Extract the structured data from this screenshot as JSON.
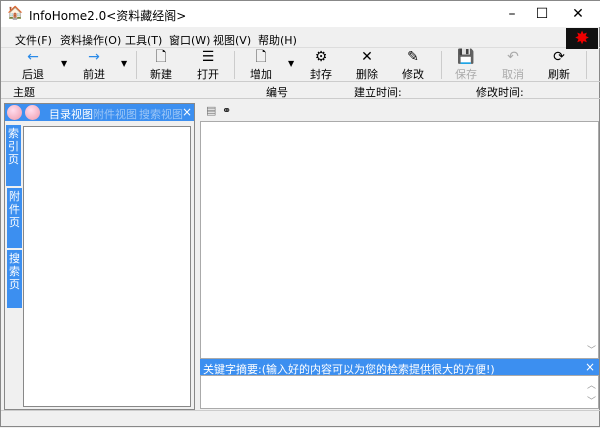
{
  "window": {
    "title": "InfoHome2.0<资料藏经阁>",
    "minimize": "–",
    "maximize": "☐",
    "close": "✕"
  },
  "menu": [
    "文件(F)",
    "资料操作(O)",
    "工具(T)",
    "窗口(W)",
    "视图(V)",
    "帮助(H)"
  ],
  "toolbar": [
    {
      "label": "后退",
      "icon": "←"
    },
    {
      "label": "前进",
      "icon": "→"
    },
    {
      "label": "新建",
      "icon": "🗋"
    },
    {
      "label": "打开",
      "icon": "☰"
    },
    {
      "label": "增加",
      "icon": "🗋"
    },
    {
      "label": "封存",
      "icon": "⚙"
    },
    {
      "label": "删除",
      "icon": "✕"
    },
    {
      "label": "修改",
      "icon": "✎"
    },
    {
      "label": "保存",
      "icon": "💾",
      "disabled": true
    },
    {
      "label": "取消",
      "icon": "↶",
      "disabled": true
    },
    {
      "label": "刷新",
      "icon": "⟳"
    }
  ],
  "header": {
    "subject": "主题",
    "number": "编号",
    "created": "建立时间:",
    "modified": "修改时间:"
  },
  "left_panel": {
    "tabs": [
      "目录视图",
      "附件视图",
      "搜索视图"
    ],
    "close": "×",
    "side_tabs": [
      "索引页",
      "附件页",
      "搜索页"
    ]
  },
  "keyword_bar": {
    "label": "关键字摘要:(输入好的内容可以为您的检索提供很大的方便!)",
    "close": "×"
  },
  "colors": {
    "accent": "#3c8ff0"
  }
}
